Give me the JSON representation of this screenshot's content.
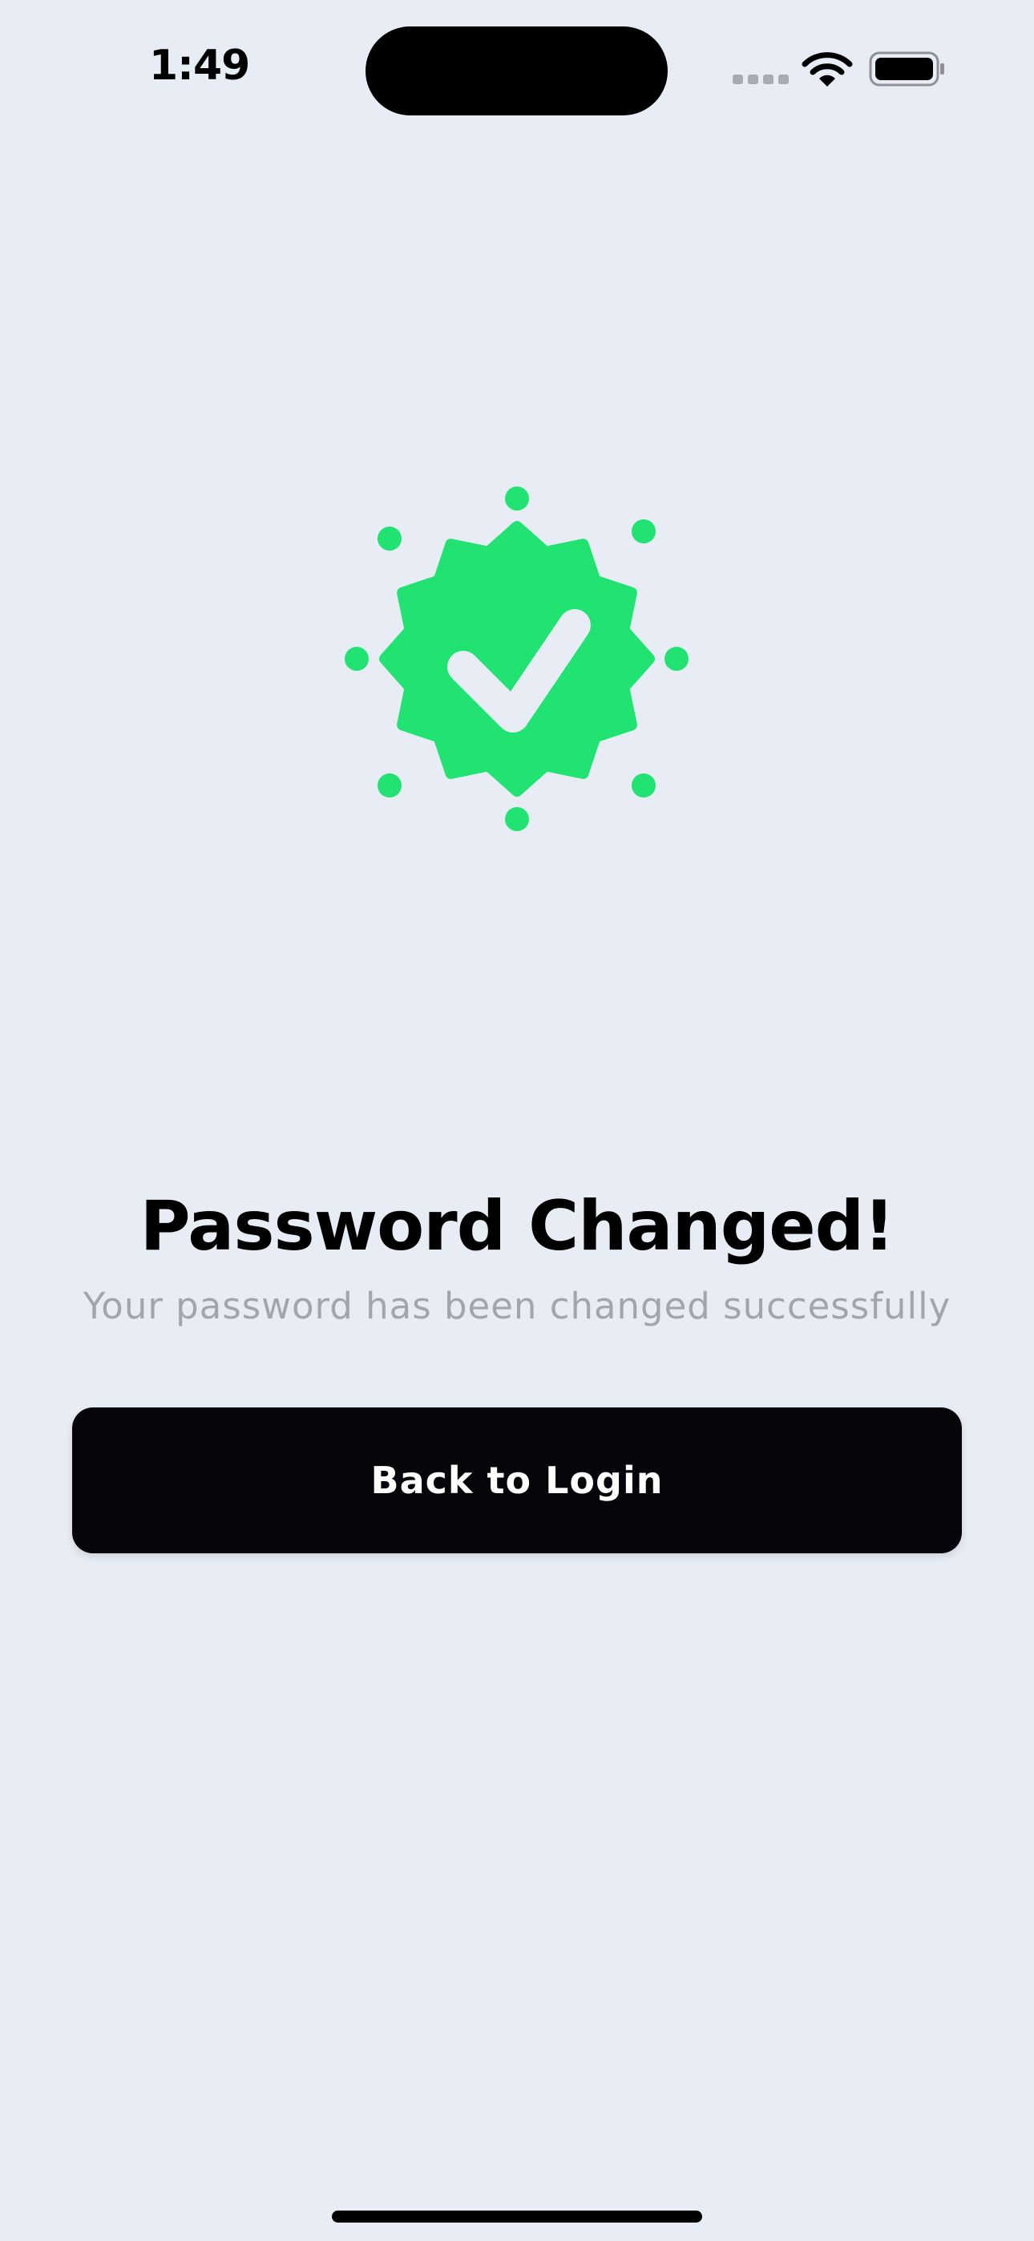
{
  "status_bar": {
    "time": "1:49",
    "icons": [
      "cellular-signal-icon",
      "wifi-icon",
      "battery-icon"
    ]
  },
  "success_badge": {
    "icon": "check-badge-icon",
    "color": "#21e372"
  },
  "title": "Password Changed!",
  "subtitle": "Your password has been changed successfully",
  "back_button": {
    "label": "Back to Login",
    "background": "#05050a"
  },
  "theme": {
    "background": "#e8edf5",
    "accent": "#21e372"
  }
}
